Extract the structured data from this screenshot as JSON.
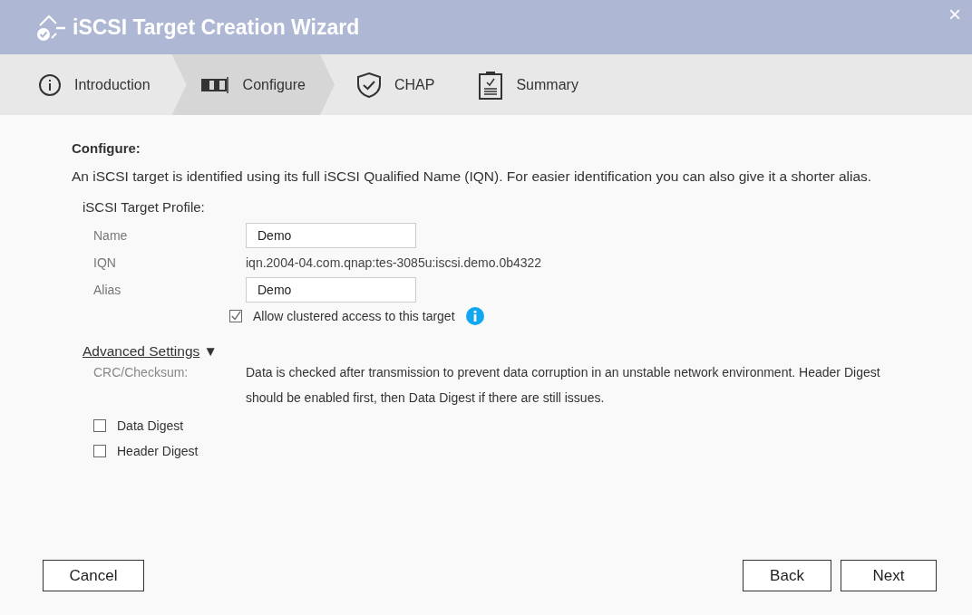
{
  "window": {
    "title": "iSCSI Target Creation Wizard",
    "close": "×"
  },
  "steps": [
    {
      "label": "Introduction",
      "kind": "info",
      "selected": false
    },
    {
      "label": "Configure",
      "kind": "disk",
      "selected": true
    },
    {
      "label": "CHAP",
      "kind": "shield",
      "selected": false
    },
    {
      "label": "Summary",
      "kind": "clipboard",
      "selected": false
    }
  ],
  "section": {
    "heading": "Configure:",
    "description": "An iSCSI target is identified using its full iSCSI Qualified Name (IQN). For easier identification you can also give it a shorter alias.",
    "profile_title": "iSCSI Target Profile:"
  },
  "fields": [
    {
      "label": "Name",
      "kind": "input",
      "value": "Demo"
    },
    {
      "label": "IQN",
      "kind": "text",
      "value": "iqn.2004-04.com.qnap:tes-3085u:iscsi.demo.0b4322"
    },
    {
      "label": "Alias",
      "kind": "input",
      "value": "Demo"
    }
  ],
  "cluster_option": {
    "label": "Allow clustered access to this target",
    "checked": true
  },
  "advanced": {
    "link": "Advanced Settings",
    "arrow": "▼",
    "expanded": true,
    "crc_label": "CRC/Checksum:",
    "crc_text": "Data is checked after transmission to prevent data corruption in an unstable network environment. Header Digest should be enabled first, then Data Digest if there are still issues.",
    "options": [
      {
        "label": "Data Digest",
        "checked": false
      },
      {
        "label": "Header Digest",
        "checked": false
      }
    ]
  },
  "buttons": {
    "cancel": "Cancel",
    "back": "Back",
    "next": "Next"
  }
}
